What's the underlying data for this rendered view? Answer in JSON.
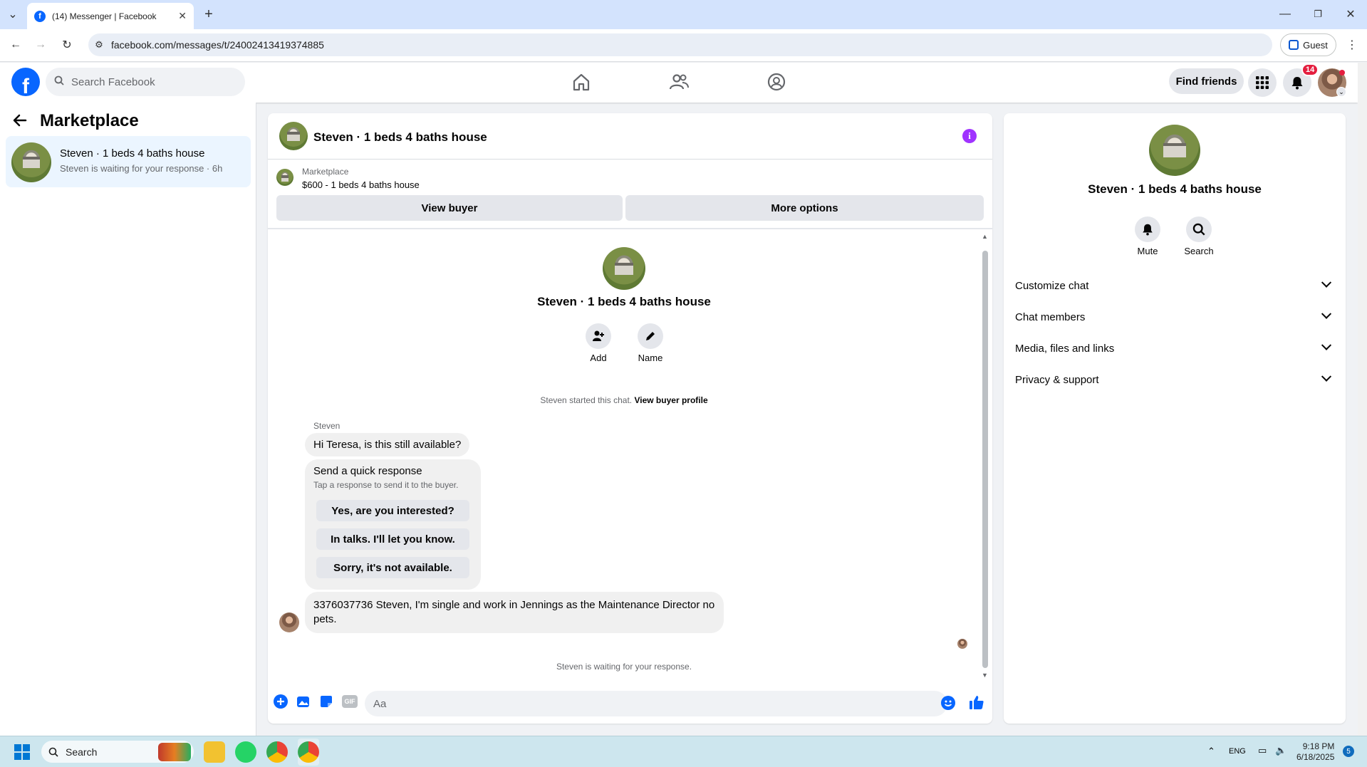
{
  "browser": {
    "tab_title": "(14) Messenger | Facebook",
    "url": "facebook.com/messages/t/24002413419374885",
    "guest_label": "Guest"
  },
  "header": {
    "search_placeholder": "Search Facebook",
    "find_friends": "Find friends",
    "notification_count": "14"
  },
  "sidebar": {
    "title": "Marketplace",
    "conversation": {
      "name": "Steven · 1 beds 4 baths house",
      "preview": "Steven is waiting for your response · 6h"
    }
  },
  "chat": {
    "title": "Steven · 1 beds 4 baths house",
    "marketplace_label": "Marketplace",
    "listing": "$600 - 1 beds 4 baths house",
    "view_buyer": "View buyer",
    "more_options": "More options",
    "center_name": "Steven · 1 beds 4 baths house",
    "add_label": "Add",
    "name_label": "Name",
    "started_text": "Steven started this chat.",
    "view_buyer_profile": "View buyer profile",
    "sender": "Steven",
    "message1": "Hi Teresa, is this still available?",
    "quick_title": "Send a quick response",
    "quick_sub": "Tap a response to send it to the buyer.",
    "quick_replies": [
      "Yes, are you interested?",
      "In talks. I'll let you know.",
      "Sorry, it's not available."
    ],
    "message2": "3376037736 Steven, I'm single and work in Jennings as the Maintenance Director no pets.",
    "waiting": "Steven is waiting for your response.",
    "composer_placeholder": "Aa"
  },
  "details": {
    "name": "Steven · 1 beds 4 baths house",
    "mute": "Mute",
    "search": "Search",
    "sections": [
      "Customize chat",
      "Chat members",
      "Media, files and links",
      "Privacy & support"
    ]
  },
  "taskbar": {
    "search": "Search",
    "lang": "ENG",
    "time": "9:18 PM",
    "date": "6/18/2025",
    "notif": "5"
  },
  "colors": {
    "fb_blue": "#0866ff",
    "info_purple": "#a033ff",
    "badge_red": "#e41e3f"
  }
}
